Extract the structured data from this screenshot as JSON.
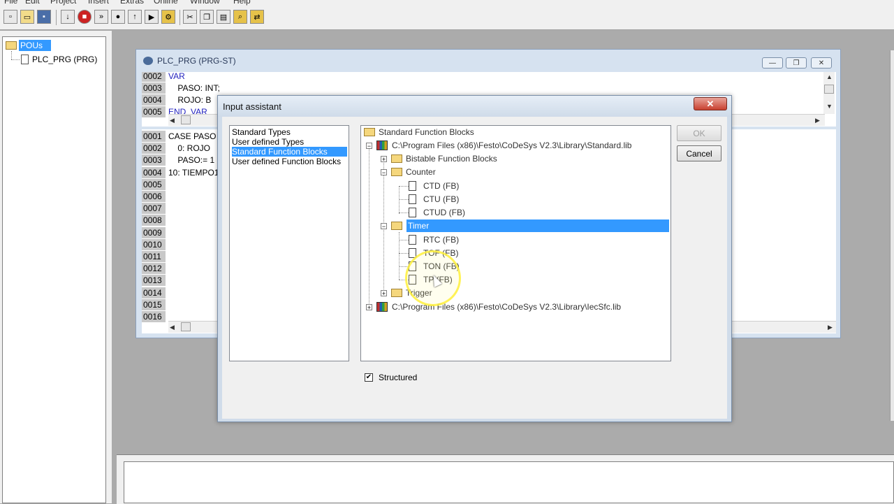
{
  "menu": [
    "File",
    "Edit",
    "Project",
    "Insert",
    "Extras",
    "Online",
    "Window",
    "Help"
  ],
  "toolbar": {
    "buttons": [
      "new-icon",
      "open-icon",
      "save-icon",
      "download-icon",
      "stop-icon",
      "step-icon",
      "breakpoint-icon",
      "upload-icon",
      "run-icon",
      "cut-icon",
      "copy-icon",
      "paste-icon",
      "find-icon",
      "replace-icon"
    ]
  },
  "pou_tree": {
    "root_label": "POUs",
    "child_label": "PLC_PRG (PRG)"
  },
  "editor": {
    "title": "PLC_PRG (PRG-ST)",
    "decl_lines": [
      {
        "num": "0002",
        "text": "VAR",
        "kw": true
      },
      {
        "num": "0003",
        "text": "    PASO: INT;"
      },
      {
        "num": "0004",
        "text": "    ROJO: B"
      },
      {
        "num": "0005",
        "text": "END_VAR",
        "kw": true
      }
    ],
    "code_lines": [
      {
        "num": "0001",
        "text": "CASE PASO"
      },
      {
        "num": "0002",
        "text": "    0: ROJO"
      },
      {
        "num": "0003",
        "text": "    PASO:= 1"
      },
      {
        "num": "0004",
        "text": "10: TIEMPO1"
      },
      {
        "num": "0005",
        "text": ""
      },
      {
        "num": "0006",
        "text": ""
      },
      {
        "num": "0007",
        "text": ""
      },
      {
        "num": "0008",
        "text": ""
      },
      {
        "num": "0009",
        "text": ""
      },
      {
        "num": "0010",
        "text": ""
      },
      {
        "num": "0011",
        "text": ""
      },
      {
        "num": "0012",
        "text": ""
      },
      {
        "num": "0013",
        "text": ""
      },
      {
        "num": "0014",
        "text": ""
      },
      {
        "num": "0015",
        "text": ""
      },
      {
        "num": "0016",
        "text": ""
      }
    ]
  },
  "dialog": {
    "title": "Input assistant",
    "close_label": "✕",
    "types": [
      "Standard Types",
      "User defined Types",
      "Standard Function Blocks",
      "User defined Function Blocks"
    ],
    "selected_type_index": 2,
    "tree": {
      "root": "Standard Function Blocks",
      "lib1": "C:\\Program Files (x86)\\Festo\\CoDeSys V2.3\\Library\\Standard.lib",
      "bistable": "Bistable Function Blocks",
      "counter": "Counter",
      "ctd": "CTD (FB)",
      "ctu": "CTU (FB)",
      "ctud": "CTUD (FB)",
      "timer": "Timer",
      "rtc": "RTC (FB)",
      "tof": "TOF (FB)",
      "ton": "TON (FB)",
      "tp": "TP (FB)",
      "trigger": "Trigger",
      "lib2": "C:\\Program Files (x86)\\Festo\\CoDeSys V2.3\\Library\\IecSfc.lib"
    },
    "ok_label": "OK",
    "cancel_label": "Cancel",
    "structured_label": "Structured",
    "structured_checked": true
  },
  "colors": {
    "selection": "#3399ff",
    "keyword": "#1e1ebe",
    "workspace": "#ababab"
  }
}
